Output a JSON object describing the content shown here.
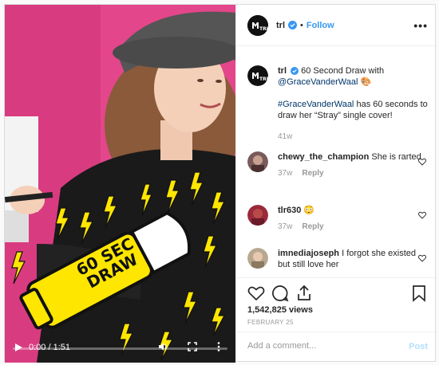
{
  "header": {
    "username": "trl",
    "separator": "•",
    "follow_label": "Follow",
    "more_icon": "more-horizontal-icon"
  },
  "caption": {
    "username": "trl",
    "text_1": "60 Second Draw with",
    "mention": "@GraceVanderWaal",
    "hashtag": "#GraceVanderWaal",
    "text_2": "has 60 seconds to draw her “Stray” single cover!",
    "time": "41w"
  },
  "comments": [
    {
      "username": "chewy_the_champion",
      "text": "She is rarted",
      "time": "37w",
      "reply": "Reply"
    },
    {
      "username": "tlr630",
      "text": "😳",
      "time": "37w",
      "reply": "Reply"
    },
    {
      "username": "imnediajoseph",
      "text": "I forgot she existed but still love her",
      "time": "",
      "reply": ""
    }
  ],
  "stats": {
    "views": "1,542,825 views",
    "date": "FEBRUARY 25"
  },
  "add_comment": {
    "placeholder": "Add a comment...",
    "post_label": "Post"
  },
  "video": {
    "time": "0:00 / 1:51",
    "progress": 0.0,
    "sticker_line1": "60 SEC",
    "sticker_line2": "DRAW"
  },
  "colors": {
    "accent": "#3897f0",
    "video_bg": "#e3468a",
    "sticker": "#ffe600"
  }
}
